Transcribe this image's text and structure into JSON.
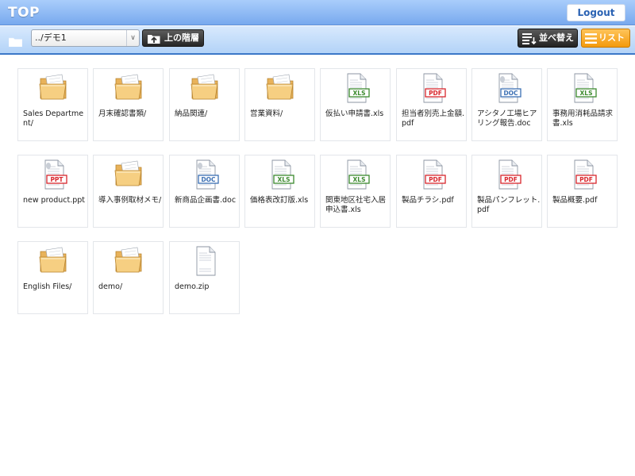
{
  "header": {
    "title": "TOP",
    "logout_label": "Logout"
  },
  "toolbar": {
    "path": "../デモ1",
    "up_label": "上の階層",
    "sort_label": "並べ替え",
    "list_label": "リスト"
  },
  "files": [
    {
      "name": "Sales Department/",
      "type": "folder"
    },
    {
      "name": "月末確認書類/",
      "type": "folder"
    },
    {
      "name": "納品関連/",
      "type": "folder"
    },
    {
      "name": "営業資料/",
      "type": "folder"
    },
    {
      "name": "仮払い申請書.xls",
      "type": "xls"
    },
    {
      "name": "担当者別売上金額.pdf",
      "type": "pdf"
    },
    {
      "name": "アシタノ工場ヒアリング報告.doc",
      "type": "doc"
    },
    {
      "name": "事務用消耗品請求書.xls",
      "type": "xls"
    },
    {
      "name": "new product.ppt",
      "type": "ppt"
    },
    {
      "name": "導入事例取材メモ/",
      "type": "folder"
    },
    {
      "name": "新商品企画書.doc",
      "type": "doc"
    },
    {
      "name": "価格表改訂版.xls",
      "type": "xls"
    },
    {
      "name": "関東地区社宅入居申込書.xls",
      "type": "xls"
    },
    {
      "name": "製品チラシ.pdf",
      "type": "pdf"
    },
    {
      "name": "製品パンフレット.pdf",
      "type": "pdf"
    },
    {
      "name": "製品概要.pdf",
      "type": "pdf"
    },
    {
      "name": "English Files/",
      "type": "folder"
    },
    {
      "name": "demo/",
      "type": "folder"
    },
    {
      "name": "demo.zip",
      "type": "zip"
    }
  ],
  "badges": {
    "xls": "XLS",
    "pdf": "PDF",
    "doc": "DOC",
    "ppt": "PPT"
  },
  "colors": {
    "xls": "#3c8a2e",
    "pdf": "#d9262c",
    "doc": "#3b6fb3",
    "ppt": "#d9262c",
    "header": "#78a9ee",
    "list_button": "#f39a0c"
  }
}
